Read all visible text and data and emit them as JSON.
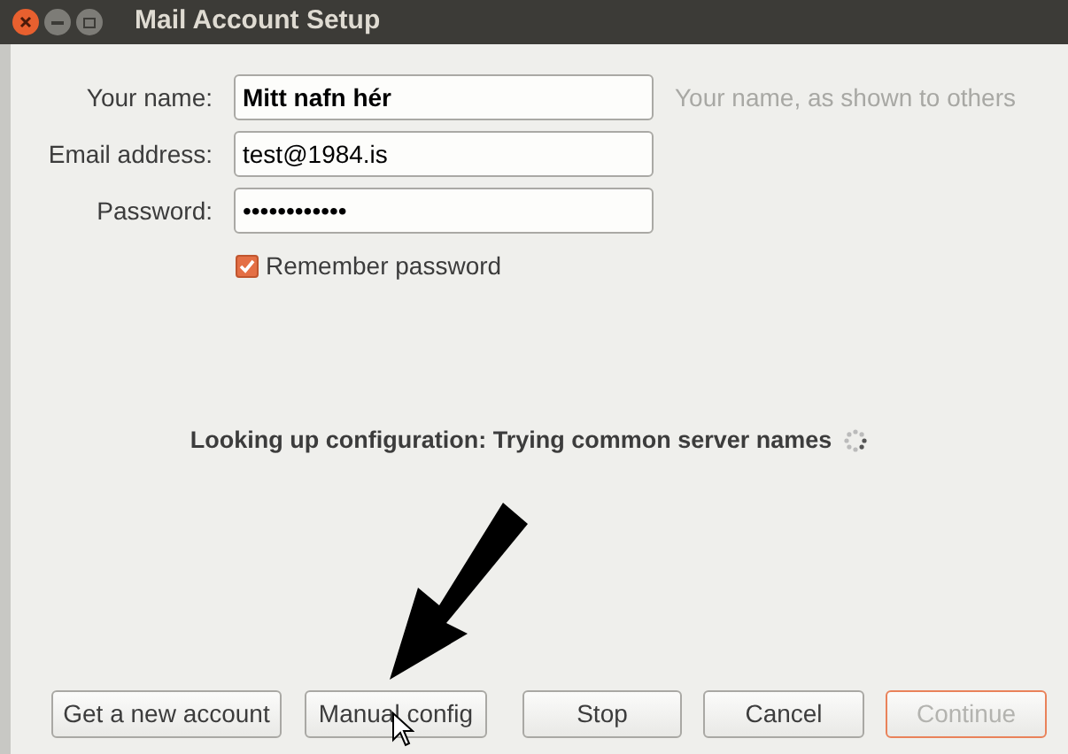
{
  "window": {
    "title": "Mail Account Setup"
  },
  "fields": [
    {
      "label": "Your name:",
      "value": "Mitt nafn hér",
      "bold": true,
      "hint": "Your name, as shown to others"
    },
    {
      "label": "Email address:",
      "value": "test@1984.is",
      "bold": false
    },
    {
      "label": "Password:",
      "value": "••••••••••••",
      "bold": false
    }
  ],
  "remember": {
    "label": "Remember password",
    "checked": true
  },
  "status": "Looking up configuration: Trying common server names",
  "buttons": [
    {
      "label": "Get a new account",
      "disabled": false,
      "focused": false
    },
    {
      "label": "Manual config",
      "disabled": false,
      "focused": false
    },
    {
      "label": "Stop",
      "disabled": false,
      "focused": false
    },
    {
      "label": "Cancel",
      "disabled": false,
      "focused": false
    },
    {
      "label": "Continue",
      "disabled": true,
      "focused": true
    }
  ]
}
